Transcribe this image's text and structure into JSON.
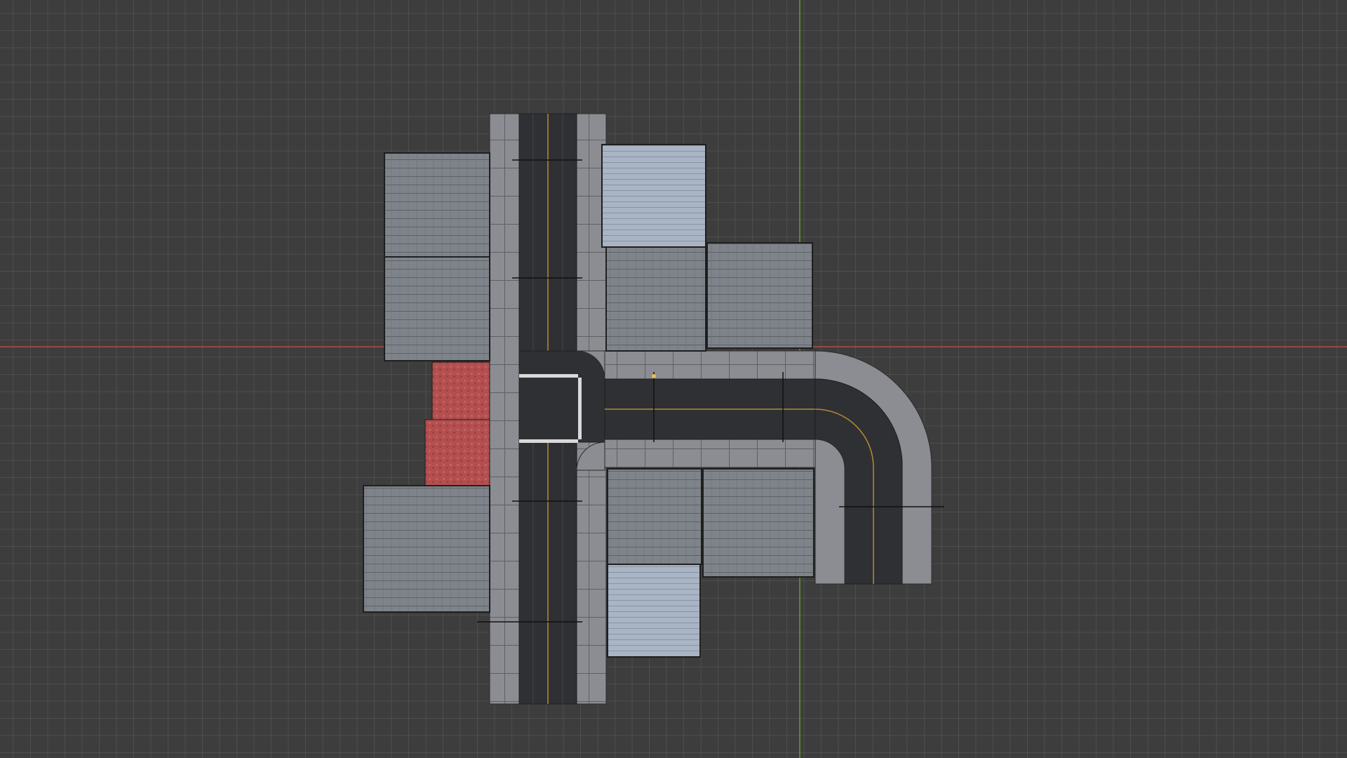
{
  "viewport": {
    "view": "top-orthographic",
    "background_color": "#3d3d3d",
    "grid_color": "#5a5a5a",
    "x_axis_color": "#b34c4c",
    "y_axis_color": "#6b9a2a"
  },
  "scene": {
    "road_color": "#2f3033",
    "sidewalk_color": "#8b8d92",
    "centerline_color": "#b38a34",
    "crosswalk_color": "#d9d9d9",
    "roof_dark_color": "#7f848b",
    "roof_light_color": "#a9b4c4",
    "brick_color": "#b44f4f"
  }
}
